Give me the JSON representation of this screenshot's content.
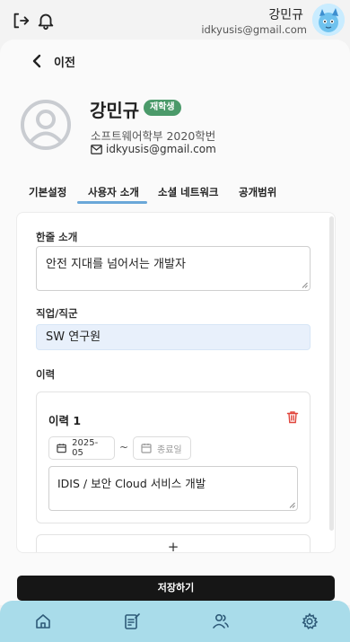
{
  "header": {
    "user_name": "강민규",
    "user_email": "idkyusis@gmail.com",
    "icons": [
      "logout-icon",
      "bell-icon",
      "avatar-icon"
    ]
  },
  "nav": {
    "back_label": "이전"
  },
  "profile": {
    "name": "강민규",
    "status_badge": "재학생",
    "department": "소프트웨어학부 2020학번",
    "email": "idkyusis@gmail.com"
  },
  "tabs": [
    {
      "label": "기본설정"
    },
    {
      "label": "사용자 소개",
      "active": true
    },
    {
      "label": "소셜 네트워크"
    },
    {
      "label": "공개범위"
    }
  ],
  "form": {
    "intro_label": "한줄 소개",
    "intro_value": "안전 지대를 넘어서는 개발자",
    "job_label": "직업/직군",
    "job_value": "SW 연구원",
    "career_label": "이력",
    "careers": [
      {
        "title": "이력 1",
        "start_date": "2025-05",
        "separator": "~",
        "end_placeholder": "종료일",
        "description": "IDIS / 보안 Cloud 서비스 개발"
      }
    ],
    "add_label": "+"
  },
  "save_label": "저장하기",
  "bottom_nav": [
    "home-icon",
    "board-edit-icon",
    "people-icon",
    "settings-icon"
  ],
  "colors": {
    "badge": "#4b9a6a",
    "tab_indicator": "#6aa7d8",
    "save_button": "#161616",
    "bottom_nav": "#a9dcea",
    "job_field_bg": "#e8f0fb",
    "delete": "#e0443b"
  }
}
